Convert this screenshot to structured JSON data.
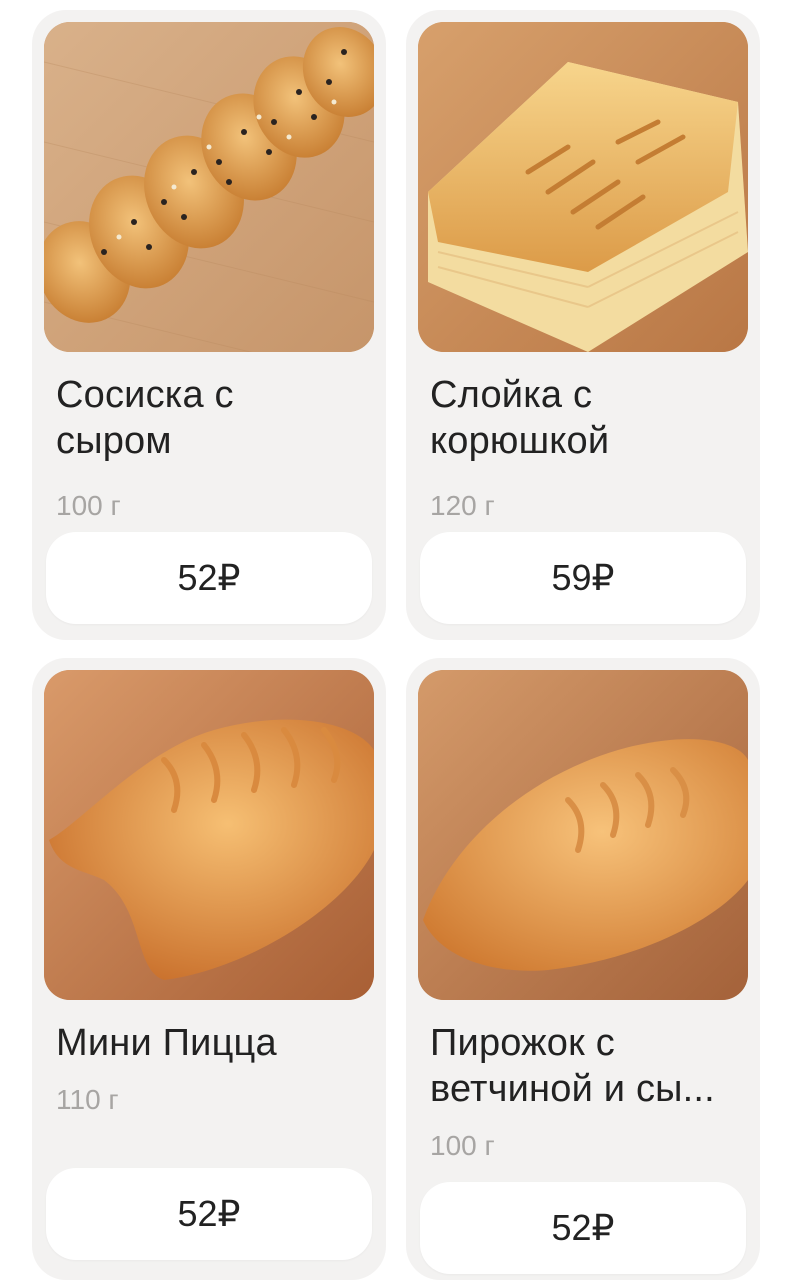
{
  "products": [
    {
      "name": "Сосиска с\nсыром",
      "weight": "100 г",
      "price": "52₽",
      "image": "sausage-braid-photo"
    },
    {
      "name": "Слойка с\nкорюшкой",
      "weight": "120 г",
      "price": "59₽",
      "image": "puff-pastry-photo"
    },
    {
      "name": "Мини Пицца",
      "weight": "110 г",
      "price": "52₽",
      "image": "pie-photo"
    },
    {
      "name": "Пирожок с\nветчиной и сы...",
      "weight": "100 г",
      "price": "52₽",
      "image": "pirozhok-photo"
    }
  ]
}
